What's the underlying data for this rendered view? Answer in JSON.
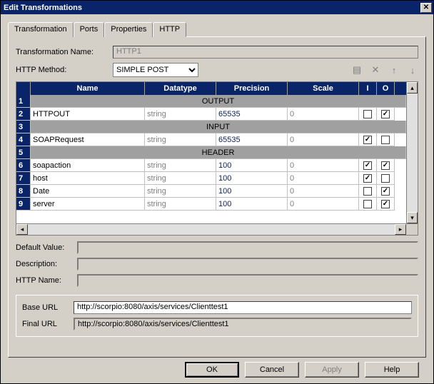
{
  "window": {
    "title": "Edit Transformations"
  },
  "tabs": [
    {
      "label": "Transformation"
    },
    {
      "label": "Ports"
    },
    {
      "label": "Properties"
    },
    {
      "label": "HTTP"
    }
  ],
  "form": {
    "name_label": "Transformation Name:",
    "name_value": "HTTP1",
    "method_label": "HTTP Method:",
    "method_value": "SIMPLE POST"
  },
  "grid": {
    "headers": {
      "name": "Name",
      "datatype": "Datatype",
      "precision": "Precision",
      "scale": "Scale",
      "i": "I",
      "o": "O"
    },
    "sections": {
      "output": "OUTPUT",
      "input": "INPUT",
      "header": "HEADER"
    },
    "rows": [
      {
        "n": "1",
        "section": "output"
      },
      {
        "n": "2",
        "name": "HTTPOUT",
        "type": "string",
        "prec": "65535",
        "scale": "0",
        "i": false,
        "o": true
      },
      {
        "n": "3",
        "section": "input"
      },
      {
        "n": "4",
        "name": "SOAPRequest",
        "type": "string",
        "prec": "65535",
        "scale": "0",
        "i": true,
        "o": false
      },
      {
        "n": "5",
        "section": "header"
      },
      {
        "n": "6",
        "name": "soapaction",
        "type": "string",
        "prec": "100",
        "scale": "0",
        "i": true,
        "o": true
      },
      {
        "n": "7",
        "name": "host",
        "type": "string",
        "prec": "100",
        "scale": "0",
        "i": true,
        "o": false
      },
      {
        "n": "8",
        "name": "Date",
        "type": "string",
        "prec": "100",
        "scale": "0",
        "i": false,
        "o": true
      },
      {
        "n": "9",
        "name": "server",
        "type": "string",
        "prec": "100",
        "scale": "0",
        "i": false,
        "o": true
      }
    ]
  },
  "fields": {
    "default_label": "Default Value:",
    "default_value": "",
    "desc_label": "Description:",
    "desc_value": "",
    "httpname_label": "HTTP Name:",
    "httpname_value": "",
    "baseurl_label": "Base URL",
    "baseurl_value": "http://scorpio:8080/axis/services/Clienttest1",
    "finalurl_label": "Final URL",
    "finalurl_value": "http://scorpio:8080/axis/services/Clienttest1"
  },
  "buttons": {
    "ok": "OK",
    "cancel": "Cancel",
    "apply": "Apply",
    "help": "Help"
  }
}
